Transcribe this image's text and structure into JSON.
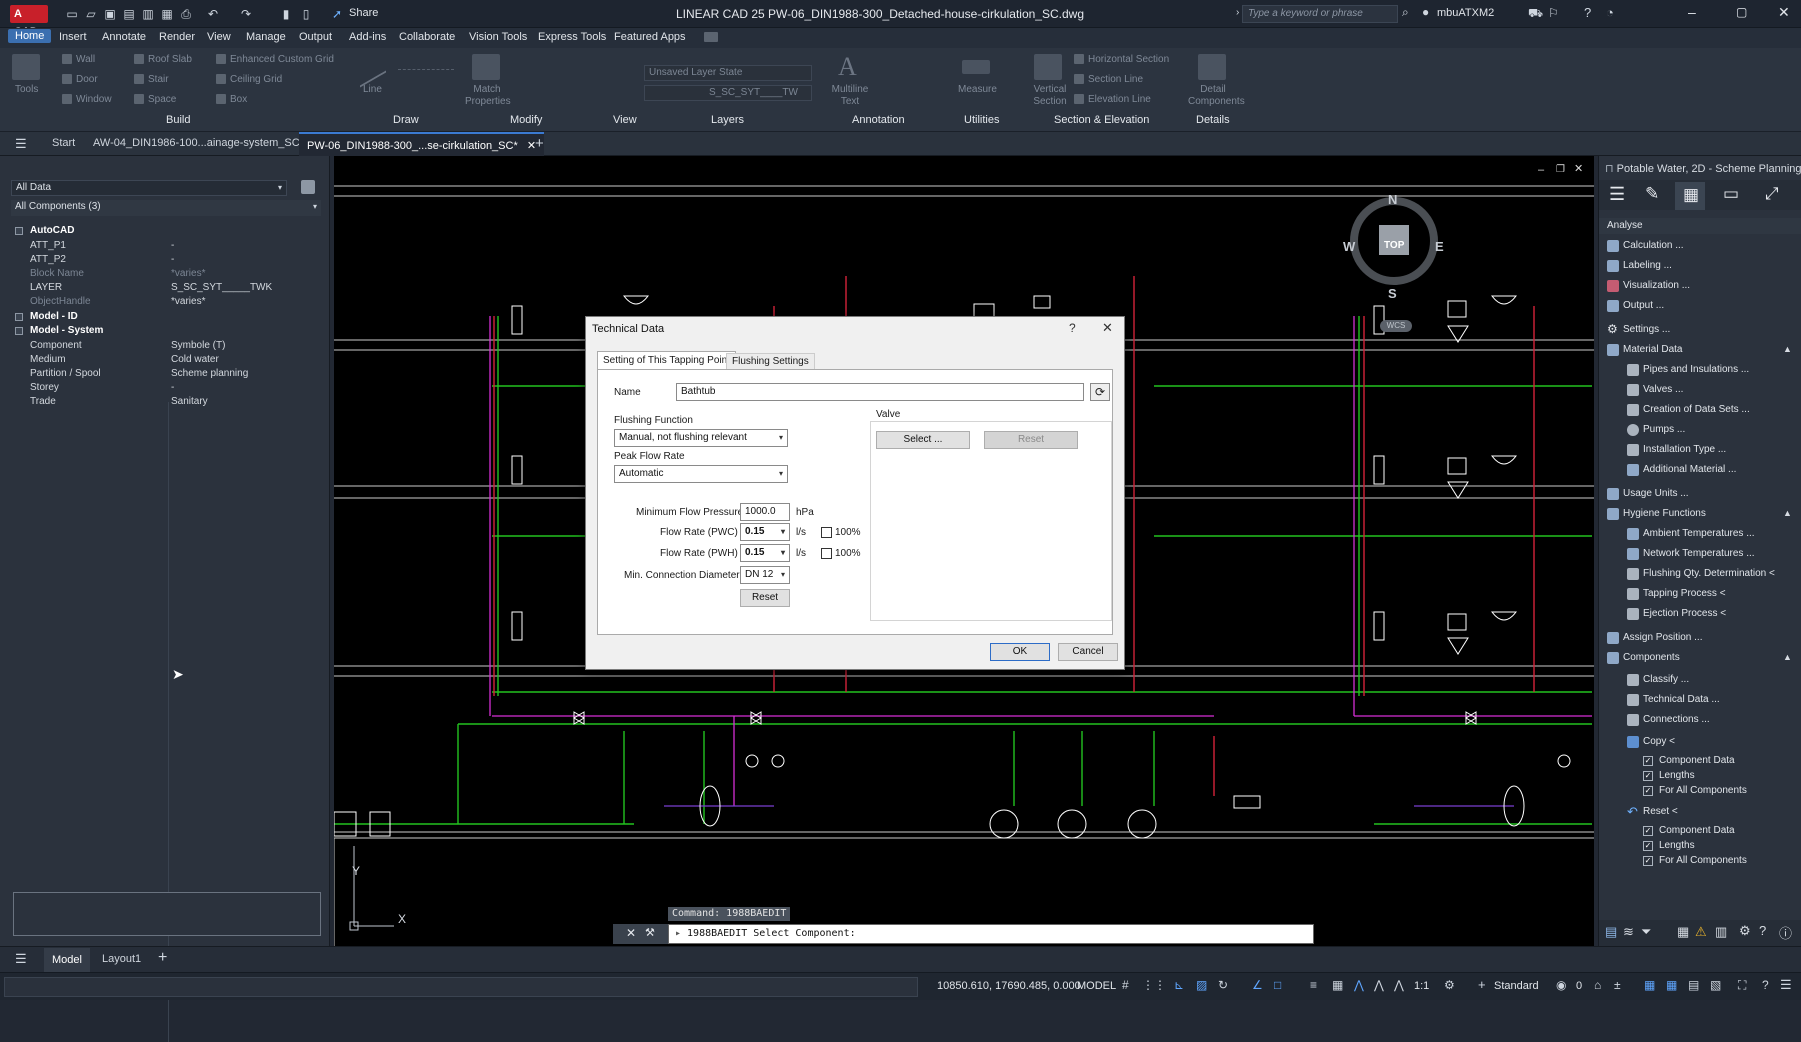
{
  "app": {
    "logo": "A CAD",
    "title": "LINEAR CAD 25   PW-06_DIN1988-300_Detached-house-cirkulation_SC.dwg",
    "share": "Share",
    "search_placeholder": "Type a keyword or phrase",
    "user": "mbuATXM2"
  },
  "menu": [
    "Home",
    "Insert",
    "Annotate",
    "Render",
    "View",
    "Manage",
    "Output",
    "Add-ins",
    "Collaborate",
    "Vision Tools",
    "Express Tools",
    "Featured Apps"
  ],
  "ribbon": {
    "tools": "Tools",
    "build_items": [
      "Wall",
      "Door",
      "Window",
      "Roof Slab",
      "Stair",
      "Space",
      "Enhanced Custom Grid",
      "Ceiling Grid",
      "Box"
    ],
    "line": "Line",
    "match_properties": "Match Properties",
    "layer_state": "Unsaved Layer State",
    "layer_name": "S_SC_SYT____TW",
    "multiline_text": "Multiline Text",
    "measure": "Measure",
    "vertical_section": "Vertical Section",
    "section_items": [
      "Horizontal Section",
      "Section Line",
      "Elevation Line"
    ],
    "detail_components": "Detail Components",
    "groups": [
      "Build",
      "Draw",
      "Modify",
      "View",
      "Layers",
      "Annotation",
      "Utilities",
      "Section & Elevation",
      "Details"
    ]
  },
  "tabs": {
    "start": "Start",
    "tab1": "AW-04_DIN1986-100...ainage-system_SC*",
    "tab2": "PW-06_DIN1988-300_...se-cirkulation_SC*"
  },
  "properties": {
    "filter": "All Data",
    "components": "All Components (3)",
    "groups": [
      {
        "name": "AutoCAD",
        "rows": [
          {
            "k": "ATT_P1",
            "v": "-"
          },
          {
            "k": "ATT_P2",
            "v": "-"
          },
          {
            "k": "Block Name",
            "v": "*varies*"
          },
          {
            "k": "LAYER",
            "v": "S_SC_SYT_____TWK"
          },
          {
            "k": "ObjectHandle",
            "v": "*varies*"
          }
        ]
      },
      {
        "name": "Model - ID",
        "rows": []
      },
      {
        "name": "Model - System",
        "rows": [
          {
            "k": "Component",
            "v": "Symbole (T)"
          },
          {
            "k": "Medium",
            "v": "Cold water"
          },
          {
            "k": "Partition / Spool",
            "v": "Scheme planning"
          },
          {
            "k": "Storey",
            "v": "-"
          },
          {
            "k": "Trade",
            "v": "Sanitary"
          }
        ]
      }
    ]
  },
  "viewcube": {
    "n": "N",
    "s": "S",
    "e": "E",
    "w": "W",
    "top": "TOP",
    "wcs": "WCS"
  },
  "ucs": {
    "x": "X",
    "y": "Y"
  },
  "dialog": {
    "title": "Technical Data",
    "help": "?",
    "tab_active": "Setting of This Tapping Point",
    "tab_other": "Flushing Settings",
    "name_label": "Name",
    "name_value": "Bathtub",
    "flushing_label": "Flushing Function",
    "flushing_value": "Manual, not flushing relevant",
    "peak_label": "Peak Flow Rate",
    "peak_value": "Automatic",
    "min_pressure_label": "Minimum Flow Pressure",
    "min_pressure_value": "1000.0",
    "min_pressure_unit": "hPa",
    "pwc_label": "Flow Rate (PWC)",
    "pwc_value": "0.15",
    "pwc_unit": "l/s",
    "pwc_pct": "100%",
    "pwh_label": "Flow Rate (PWH)",
    "pwh_value": "0.15",
    "pwh_unit": "l/s",
    "pwh_pct": "100%",
    "diam_label": "Min. Connection Diameter",
    "diam_value": "DN 12",
    "reset": "Reset",
    "valve_label": "Valve",
    "select": "Select ...",
    "valve_reset": "Reset",
    "ok": "OK",
    "cancel": "Cancel"
  },
  "command": {
    "history": "Command: 1988BAEDIT",
    "prompt": "1988BAEDIT Select Component:"
  },
  "right": {
    "title": "Potable Water, 2D - Scheme Planning",
    "analyse": "Analyse",
    "items": [
      "Calculation ...",
      "Labeling ...",
      "Visualization ...",
      "Output ..."
    ],
    "settings": "Settings ...",
    "material": "Material Data",
    "material_items": [
      "Pipes and Insulations ...",
      "Valves ...",
      "Creation of Data Sets ...",
      "Pumps ...",
      "Installation Type ...",
      "Additional Material ..."
    ],
    "usage": "Usage Units ...",
    "hygiene": "Hygiene Functions",
    "hygiene_items": [
      "Ambient Temperatures ...",
      "Network Temperatures ...",
      "Flushing Qty. Determination <",
      "Tapping Process <",
      "Ejection Process <"
    ],
    "assign": "Assign Position ...",
    "components": "Components",
    "comp_items": [
      "Classify ...",
      "Technical Data ...",
      "Connections ..."
    ],
    "copy": "Copy <",
    "copy_opts": [
      "Component Data",
      "Lengths",
      "For All Components"
    ],
    "reset": "Reset <",
    "reset_opts": [
      "Component Data",
      "Lengths",
      "For All Components"
    ]
  },
  "layouts": {
    "model": "Model",
    "layout1": "Layout1"
  },
  "status": {
    "coords": "10850.610, 17690.485, 0.000",
    "space": "MODEL",
    "scale": "1:1",
    "style": "Standard",
    "zero": "0"
  },
  "colors": {
    "accent": "#3b7ad1",
    "green": "#22c21f",
    "red": "#d3233a",
    "magenta": "#d52fd5",
    "purple": "#7a3fd0",
    "white": "#ffffff"
  }
}
